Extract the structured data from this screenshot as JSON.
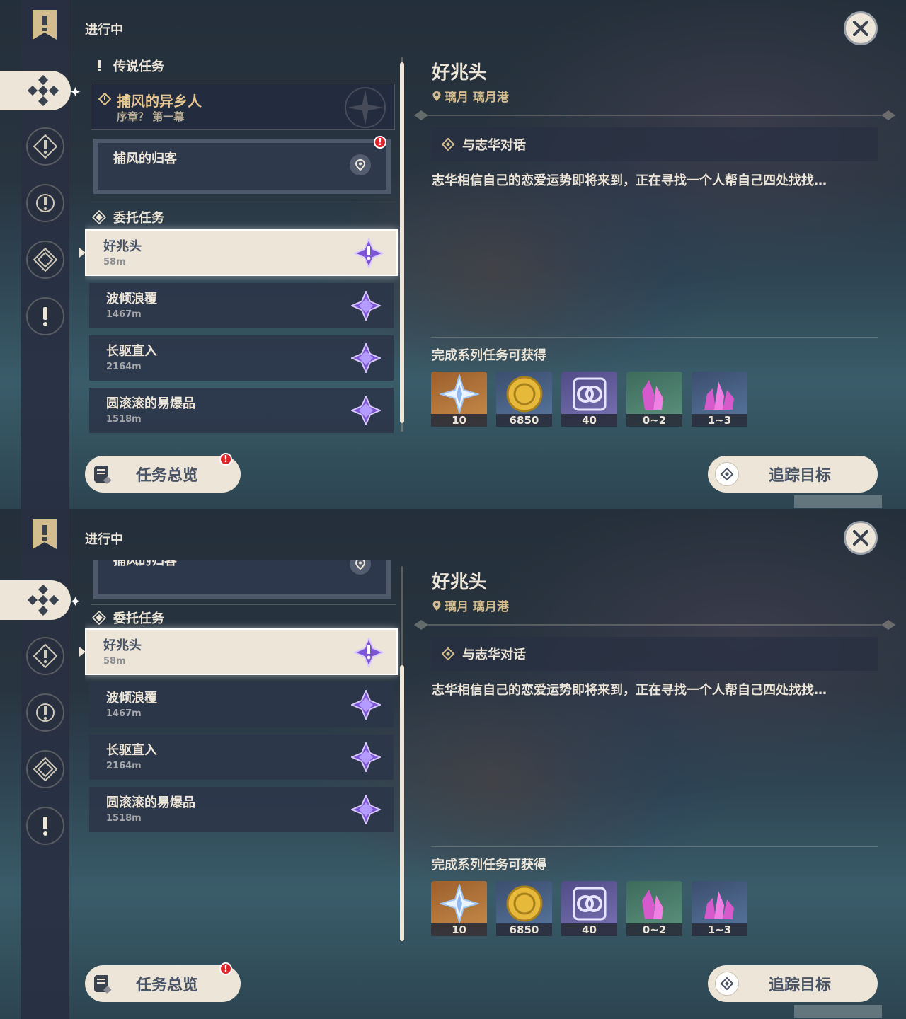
{
  "screens": [
    {
      "status_label": "进行中",
      "sections": {
        "legend_label": "传说任务",
        "chapter_title": "捕风的异乡人",
        "chapter_subtitle": "序章？ 第一幕",
        "subtask_title": "捕风的归客",
        "subtask_alert": "!",
        "commission_label": "委托任务"
      },
      "quests": [
        {
          "title": "好兆头",
          "distance": "58m",
          "selected": true
        },
        {
          "title": "波倾浪覆",
          "distance": "1467m",
          "selected": false
        },
        {
          "title": "长驱直入",
          "distance": "2164m",
          "selected": false
        },
        {
          "title": "圆滚滚的易爆品",
          "distance": "1518m",
          "selected": false
        }
      ],
      "detail": {
        "title": "好兆头",
        "location": "璃月 璃月港",
        "objective": "与志华对话",
        "description": "志华相信自己的恋爱运势即将来到，正在寻找一个人帮自己四处找找…",
        "reward_title": "完成系列任务可获得",
        "rewards": [
          {
            "icon": "primogem-icon",
            "count": "10"
          },
          {
            "icon": "mora-icon",
            "count": "6850"
          },
          {
            "icon": "adventure-exp-icon",
            "count": "40"
          },
          {
            "icon": "crystal-ore-icon",
            "count": "0~2"
          },
          {
            "icon": "crystal-chunk-icon",
            "count": "1~3"
          }
        ]
      },
      "buttons": {
        "overview": "任务总览",
        "overview_alert": "!",
        "track": "追踪目标"
      }
    },
    {
      "status_label": "进行中",
      "sections": {
        "subtask_title": "捕风的归客",
        "commission_label": "委托任务"
      },
      "quests": [
        {
          "title": "好兆头",
          "distance": "58m",
          "selected": true
        },
        {
          "title": "波倾浪覆",
          "distance": "1467m",
          "selected": false
        },
        {
          "title": "长驱直入",
          "distance": "2164m",
          "selected": false
        },
        {
          "title": "圆滚滚的易爆品",
          "distance": "1518m",
          "selected": false
        }
      ],
      "detail": {
        "title": "好兆头",
        "location": "璃月 璃月港",
        "objective": "与志华对话",
        "description": "志华相信自己的恋爱运势即将来到，正在寻找一个人帮自己四处找找…",
        "reward_title": "完成系列任务可获得",
        "rewards": [
          {
            "icon": "primogem-icon",
            "count": "10"
          },
          {
            "icon": "mora-icon",
            "count": "6850"
          },
          {
            "icon": "adventure-exp-icon",
            "count": "40"
          },
          {
            "icon": "crystal-ore-icon",
            "count": "0~2"
          },
          {
            "icon": "crystal-chunk-icon",
            "count": "1~3"
          }
        ]
      },
      "buttons": {
        "overview": "任务总览",
        "overview_alert": "!",
        "track": "追踪目标"
      }
    }
  ],
  "colors": {
    "accent_gold": "#d3bc8e",
    "panel_light": "#ece5d8",
    "alert_red": "#e0242a",
    "quest_purple": "#7b55d6"
  }
}
